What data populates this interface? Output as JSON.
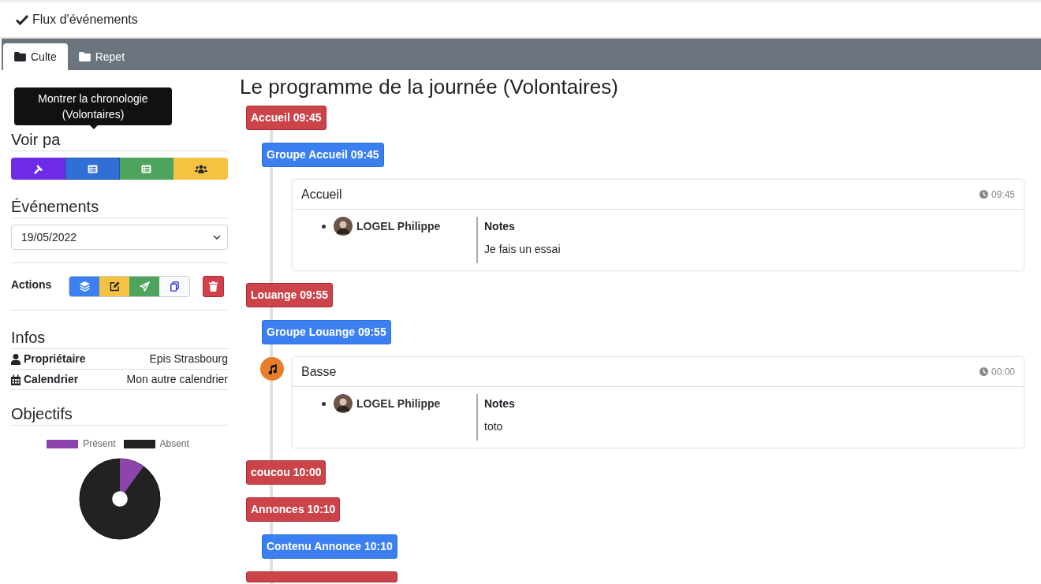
{
  "top_bar": {
    "title": "Flux d'événements"
  },
  "tabs": [
    {
      "label": "Culte",
      "selected": true
    },
    {
      "label": "Repet",
      "selected": false
    }
  ],
  "sidebar": {
    "view_heading": "Voir pa",
    "tooltip": "Montrer la chronologie (Volontaires)",
    "view_buttons": [
      {
        "kind": "hammer",
        "color": "#6f2ce8",
        "selected": false
      },
      {
        "kind": "list",
        "color": "#2f6fd6",
        "selected": true
      },
      {
        "kind": "list",
        "color": "#4ea45c",
        "selected": false
      },
      {
        "kind": "users",
        "color": "#f5c242",
        "selected": false
      }
    ],
    "events_heading": "Événements",
    "event_select": "19/05/2022",
    "actions_label": "Actions",
    "action_buttons": [
      {
        "kind": "layers",
        "color": "#3b7ff0"
      },
      {
        "kind": "edit",
        "color": "#f5c242"
      },
      {
        "kind": "send",
        "color": "#4ea45c"
      },
      {
        "kind": "copy",
        "color": "#f8f9fa"
      }
    ],
    "infos_heading": "Infos",
    "infos": [
      {
        "kind": "user",
        "label": "Propriétaire",
        "value": "Epis Strasbourg"
      },
      {
        "kind": "calendar",
        "label": "Calendrier",
        "value": "Mon autre calendrier"
      }
    ],
    "goals_heading": "Objectifs",
    "goals_chart": {
      "legend": [
        {
          "label": "Présent",
          "color": "#8e44ad"
        },
        {
          "label": "Absent",
          "color": "#222222"
        }
      ]
    }
  },
  "main": {
    "title": "Le programme de la journée (Volontaires)",
    "timeline": [
      {
        "kind": "section",
        "label": "Accueil 09:45"
      },
      {
        "kind": "group",
        "label": "Groupe Accueil 09:45"
      },
      {
        "kind": "card",
        "title": "Accueil",
        "time": "09:45",
        "music": false,
        "person": "LOGEL Philippe",
        "notes_label": "Notes",
        "notes": "Je fais un essai"
      },
      {
        "kind": "section",
        "label": "Louange 09:55"
      },
      {
        "kind": "group",
        "label": "Groupe Louange 09:55"
      },
      {
        "kind": "card",
        "title": "Basse",
        "time": "00:00",
        "music": true,
        "person": "LOGEL Philippe",
        "notes_label": "Notes",
        "notes": "toto"
      },
      {
        "kind": "section",
        "label": "coucou 10:00"
      },
      {
        "kind": "section",
        "label": "Annonces 10:10"
      },
      {
        "kind": "group",
        "label": "Contenu Annonce 10:10"
      },
      {
        "kind": "section-cut"
      }
    ]
  }
}
